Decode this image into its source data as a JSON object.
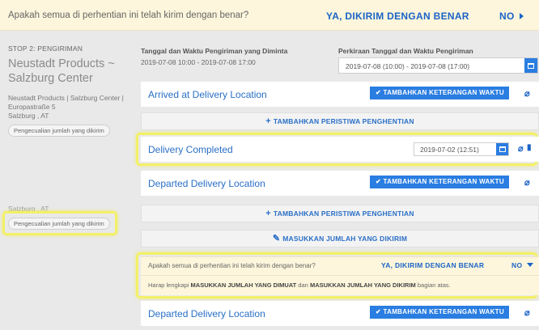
{
  "banner": {
    "question": "Apakah semua di perhentian ini telah kirim dengan benar?",
    "yes": "YA, DIKIRIM DENGAN BENAR",
    "no": "NO"
  },
  "stop": {
    "label": "STOP 2: PENGIRIMAN",
    "title": "Neustadt Products ~ Salzburg Center",
    "address_lines": [
      "Neustadt Products | Salzburg Center |",
      "Europastraße 5",
      "Salzburg , AT"
    ],
    "exception_pill": "Pengecualian jumlah yang dikirim",
    "location2": "Salzburg , AT",
    "exception_pill2": "Pengecualian jumlah yang dikirim"
  },
  "columns": {
    "requested_header": "Tanggal dan Waktu Pengiriman yang Diminta",
    "requested_value": "2019-07-08 10:00 - 2019-07-08 17:00",
    "estimated_header": "Perkiraan Tanggal dan Waktu Pengiriman",
    "estimated_value": "2019-07-08 (10:00) - 2019-07-08 (17:00)"
  },
  "events": {
    "arrived": "Arrived at Delivery Location",
    "completed": "Delivery Completed",
    "completed_date": "2019-07-02 (12:51)",
    "departed": "Departed Delivery Location",
    "departed2": "Departed Delivery Location",
    "add_time_label": "TAMBAHKAN KETERANGAN WAKTU"
  },
  "actions": {
    "add_stop_event": "TAMBAHKAN PERISTIWA PENGHENTIAN",
    "enter_delivered_qty": "MASUKKAN JUMLAH YANG DIKIRIM"
  },
  "warning": {
    "question": "Apakah semua di perhentian ini telah kirim dengan benar?",
    "yes": "YA, DIKIRIM DENGAN BENAR",
    "no": "NO",
    "msg_prefix": "Harap lengkapi",
    "msg_loaded": "MASUKKAN JUMLAH YANG DIMUAT",
    "msg_and": "dan",
    "msg_delivered": "MASUKKAN JUMLAH YANG DIKIRIM",
    "msg_suffix": "bagian atas."
  },
  "colors": {
    "accent": "#2a7de1",
    "link": "#1b63c6",
    "highlight": "#f3f066",
    "banner_bg": "#fdf6dc"
  }
}
